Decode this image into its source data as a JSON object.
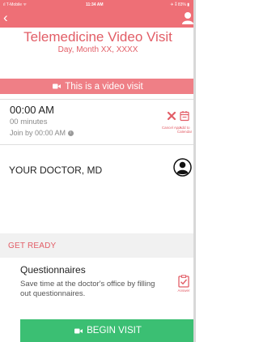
{
  "status_bar": {
    "carrier": "ıl T-Mobile ᯤ",
    "time": "11:34 AM",
    "battery": "✈ ⁑ 83% ▮"
  },
  "nav": {
    "back_icon": "chevron-left-icon",
    "user_icon": "user-icon"
  },
  "visit": {
    "title": "Telemedicine Video Visit",
    "date": "Day, Month XX, XXXX"
  },
  "banner": {
    "text": "This is a video visit"
  },
  "appointment": {
    "time": "00:00 AM",
    "duration": "00 minutes",
    "join_text": "Join by 00:00 AM"
  },
  "actions": {
    "cancel_label": "Cancel Appt",
    "calendar_label": "Add to Calendar"
  },
  "doctor": {
    "name": "YOUR DOCTOR, MD"
  },
  "get_ready": {
    "heading": "GET READY"
  },
  "questionnaires": {
    "title": "Questionnaires",
    "description": "Save time at the doctor's office by filling out questionnaires.",
    "answer_label": "Answer"
  },
  "begin_button": {
    "label": "BEGIN VISIT"
  },
  "colors": {
    "accent": "#e25d66",
    "header": "#ee6f76",
    "banner": "#ef7f86",
    "success": "#3bbf73"
  }
}
